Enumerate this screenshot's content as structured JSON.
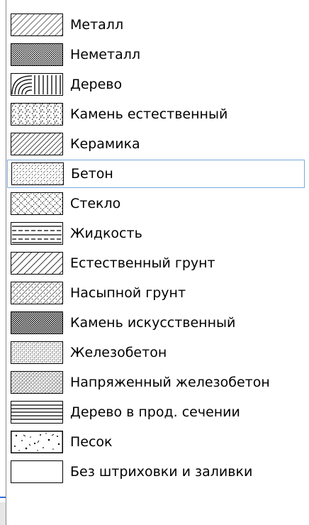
{
  "hatch_list": {
    "selected_index": 5,
    "items": [
      {
        "label": "Металл",
        "pattern": "metal-hatch"
      },
      {
        "label": "Неметалл",
        "pattern": "nonmetal-hatch"
      },
      {
        "label": "Дерево",
        "pattern": "wood-hatch"
      },
      {
        "label": "Камень естественный",
        "pattern": "natural-stone-hatch"
      },
      {
        "label": "Керамика",
        "pattern": "ceramic-hatch"
      },
      {
        "label": "Бетон",
        "pattern": "concrete-hatch"
      },
      {
        "label": "Стекло",
        "pattern": "glass-hatch"
      },
      {
        "label": "Жидкость",
        "pattern": "liquid-hatch"
      },
      {
        "label": "Естественный грунт",
        "pattern": "natural-soil-hatch"
      },
      {
        "label": "Насыпной грунт",
        "pattern": "fill-soil-hatch"
      },
      {
        "label": "Камень искусственный",
        "pattern": "artificial-stone-hatch"
      },
      {
        "label": "Железобетон",
        "pattern": "reinforced-concrete-hatch"
      },
      {
        "label": "Напряженный железобетон",
        "pattern": "prestressed-concrete-hatch"
      },
      {
        "label": "Дерево в прод. сечении",
        "pattern": "wood-longitudinal-hatch"
      },
      {
        "label": "Песок",
        "pattern": "sand-hatch"
      },
      {
        "label": "Без штриховки и заливки",
        "pattern": "no-hatch"
      }
    ]
  },
  "colors": {
    "selection_border": "#7aa7df",
    "swatch_border": "#000000",
    "background": "#ffffff"
  }
}
